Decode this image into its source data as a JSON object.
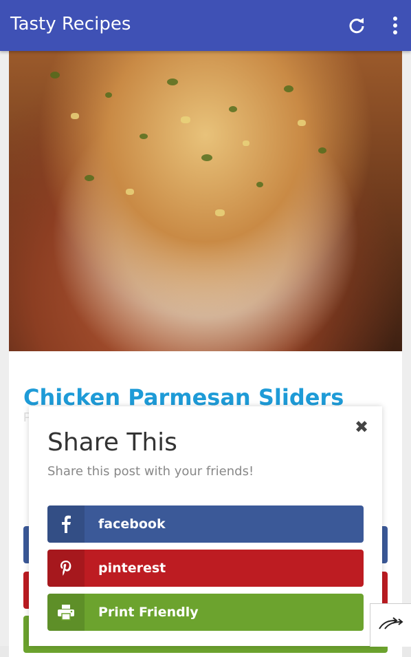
{
  "appbar": {
    "title": "Tasty Recipes",
    "actions": [
      "refresh-icon",
      "more-vert-icon"
    ]
  },
  "recipe": {
    "title": "Chicken Parmesan Sliders",
    "faint_text": "P"
  },
  "share_popup": {
    "heading": "Share This",
    "subtitle": "Share this post with your friends!",
    "close_icon": "close-icon",
    "buttons": [
      {
        "label": "facebook",
        "icon": "facebook-icon",
        "color": "#3b5998"
      },
      {
        "label": "pinterest",
        "icon": "pinterest-icon",
        "color": "#bd1c22"
      },
      {
        "label": "Print Friendly",
        "icon": "printer-icon",
        "color": "#6ca32e"
      }
    ]
  },
  "colors": {
    "appbar": "#3f51b5",
    "title_accent": "#1e9bd7"
  },
  "floating_share": {
    "icon": "share-arrow-icon"
  }
}
